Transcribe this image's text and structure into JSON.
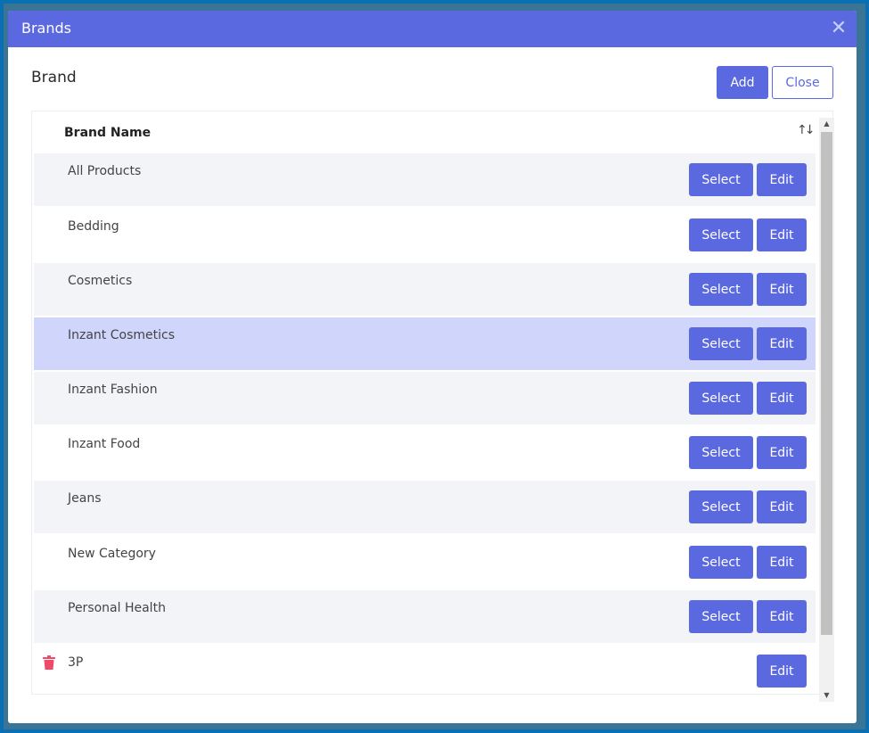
{
  "modal": {
    "title": "Brands",
    "close_icon": "close-icon"
  },
  "section": {
    "title": "Brand"
  },
  "toolbar": {
    "add_label": "Add",
    "close_label": "Close"
  },
  "table": {
    "column_header": "Brand Name",
    "sort_icon": "sort-icon",
    "rows": [
      {
        "label": "All Products",
        "select_label": "Select",
        "edit_label": "Edit"
      },
      {
        "label": "Bedding",
        "select_label": "Select",
        "edit_label": "Edit"
      },
      {
        "label": "Cosmetics",
        "select_label": "Select",
        "edit_label": "Edit"
      },
      {
        "label": "Inzant Cosmetics",
        "select_label": "Select",
        "edit_label": "Edit",
        "selected": true
      },
      {
        "label": "Inzant Fashion",
        "select_label": "Select",
        "edit_label": "Edit"
      },
      {
        "label": "Inzant Food",
        "select_label": "Select",
        "edit_label": "Edit"
      },
      {
        "label": "Jeans",
        "select_label": "Select",
        "edit_label": "Edit"
      },
      {
        "label": "New Category",
        "select_label": "Select",
        "edit_label": "Edit"
      },
      {
        "label": "Personal Health",
        "select_label": "Select",
        "edit_label": "Edit"
      },
      {
        "label": "3P",
        "edit_label": "Edit",
        "deletable": true
      }
    ]
  },
  "colors": {
    "accent": "#5b69e0",
    "selected_row": "#cfd5fb",
    "alt_row": "#f3f4f7",
    "delete": "#f04a6a"
  }
}
